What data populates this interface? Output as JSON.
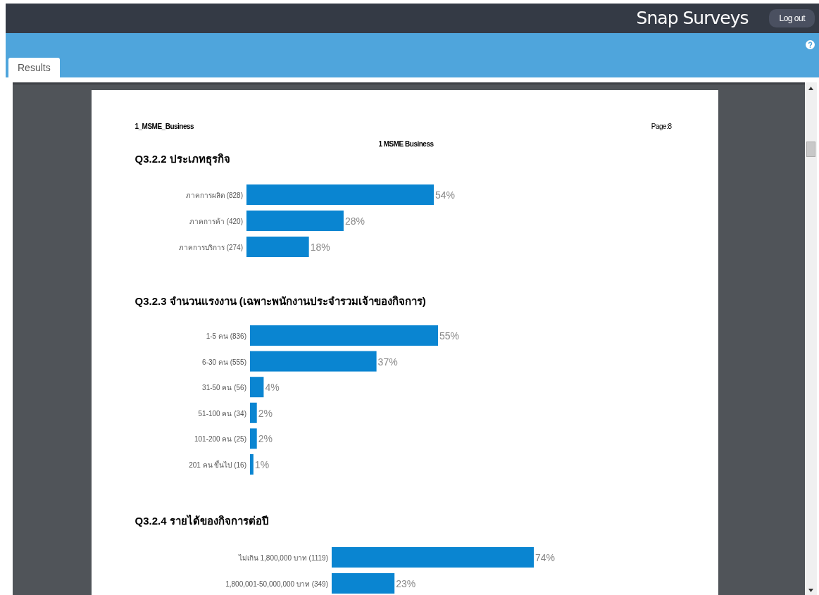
{
  "header": {
    "logo": "Snap Surveys",
    "logout_button": "Log out"
  },
  "tabs": [
    {
      "label": "Results",
      "selected": true
    }
  ],
  "document": {
    "file_name": "1_MSME_Business",
    "page": "Page:8",
    "title": "1 MSME Business",
    "questions": [
      {
        "title": "Q3.2.2 ประเภทธุรกิจ",
        "chart_data": {
          "type": "bar",
          "orientation": "horizontal",
          "categories": [
            "ภาคการผลิต (828)",
            "ภาคการค้า (420)",
            "ภาคการบริการ  (274)"
          ],
          "values": [
            54,
            28,
            18
          ],
          "value_labels": [
            "54%",
            "28%",
            "18%"
          ]
        }
      },
      {
        "title": "Q3.2.3 จำนวนแรงงาน (เฉพาะพนักงานประจำรวมเจ้าของกิจการ)",
        "chart_data": {
          "type": "bar",
          "orientation": "horizontal",
          "categories": [
            "1-5 คน (836)",
            "6-30 คน  (555)",
            "31-50 คน (56)",
            "51-100 คน (34)",
            "101-200 คน (25)",
            "201 คน ขึ้นไป (16)"
          ],
          "values": [
            55,
            37,
            4,
            2,
            2,
            1
          ],
          "value_labels": [
            "55%",
            "37%",
            "4%",
            "2%",
            "2%",
            "1%"
          ]
        }
      },
      {
        "title": "Q3.2.4 รายได้ของกิจการต่อปี",
        "chart_data": {
          "type": "bar",
          "orientation": "horizontal",
          "categories": [
            "ไม่เกิน 1,800,000 บาท (1119)",
            "1,800,001-50,000,000 บาท (349)"
          ],
          "values": [
            74,
            23
          ],
          "value_labels": [
            "74%",
            "23%"
          ]
        }
      }
    ]
  }
}
